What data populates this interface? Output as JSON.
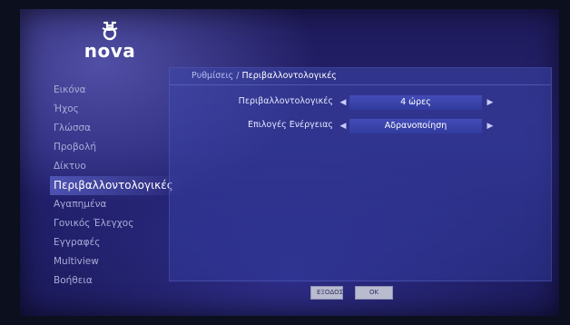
{
  "brand": {
    "name": "nova"
  },
  "sidebar": {
    "items": [
      {
        "label": "Εικόνα",
        "active": false
      },
      {
        "label": "Ήχος",
        "active": false
      },
      {
        "label": "Γλώσσα",
        "active": false
      },
      {
        "label": "Προβολή",
        "active": false
      },
      {
        "label": "Δίκτυο",
        "active": false
      },
      {
        "label": "Περιβαλλοντολογικές",
        "active": true
      },
      {
        "label": "Αγαπημένα",
        "active": false
      },
      {
        "label": "Γονικός Έλεγχος",
        "active": false
      },
      {
        "label": "Εγγραφές",
        "active": false
      },
      {
        "label": "Multiview",
        "active": false
      },
      {
        "label": "Βοήθεια",
        "active": false
      }
    ]
  },
  "breadcrumb": {
    "parent": "Ρυθμίσεις",
    "separator": " / ",
    "current": "Περιβαλλοντολογικές"
  },
  "settings": [
    {
      "label": "Περιβαλλοντολογικές",
      "value": "4 ώρες"
    },
    {
      "label": "Επιλογές Ενέργειας",
      "value": "Αδρανοποίηση"
    }
  ],
  "buttons": {
    "exit": "ΕΞΟΔΟΣ",
    "ok": "OK"
  },
  "icons": {
    "logo": "nova-logo-icon",
    "left": "chevron-left-icon",
    "right": "chevron-right-icon"
  },
  "colors": {
    "background": "#262475",
    "accent": "#6e78e6"
  }
}
